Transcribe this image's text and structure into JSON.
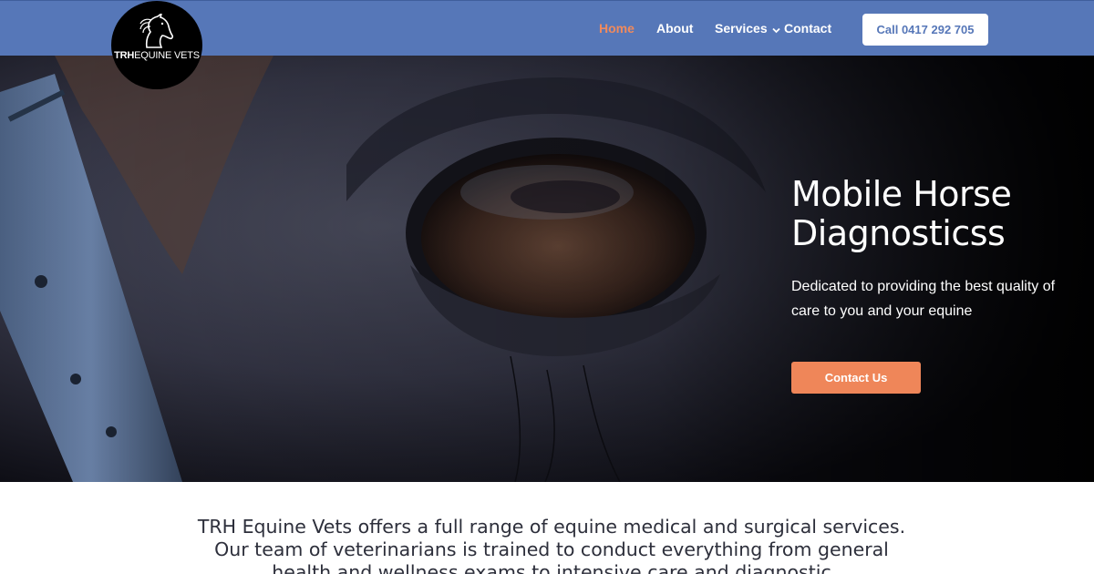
{
  "header": {
    "logo": {
      "brand": "TRH",
      "name": "EQUINE VETS",
      "icon": "horse-head-icon"
    },
    "nav": [
      {
        "label": "Home",
        "active": true
      },
      {
        "label": "About",
        "active": false
      },
      {
        "label": "Services",
        "active": false,
        "has_dropdown": true,
        "dropdown_icon": "chevron-down-icon"
      },
      {
        "label": "Contact",
        "active": false
      }
    ],
    "call_button": "Call 0417 292 705"
  },
  "hero": {
    "title": "Mobile Horse Diagnosticss",
    "subtitle": "Dedicated to providing the best quality of care to you and your equine",
    "cta": "Contact Us"
  },
  "intro": {
    "text": "TRH Equine Vets offers a full range of equine medical and surgical services. Our team of veterinarians is trained to conduct everything from general health and wellness exams to intensive care and diagnostic"
  },
  "colors": {
    "header_bg": "#5677b8",
    "active_nav": "#f08a5d",
    "cta_bg": "#ef8659",
    "call_text": "#5677b8"
  }
}
